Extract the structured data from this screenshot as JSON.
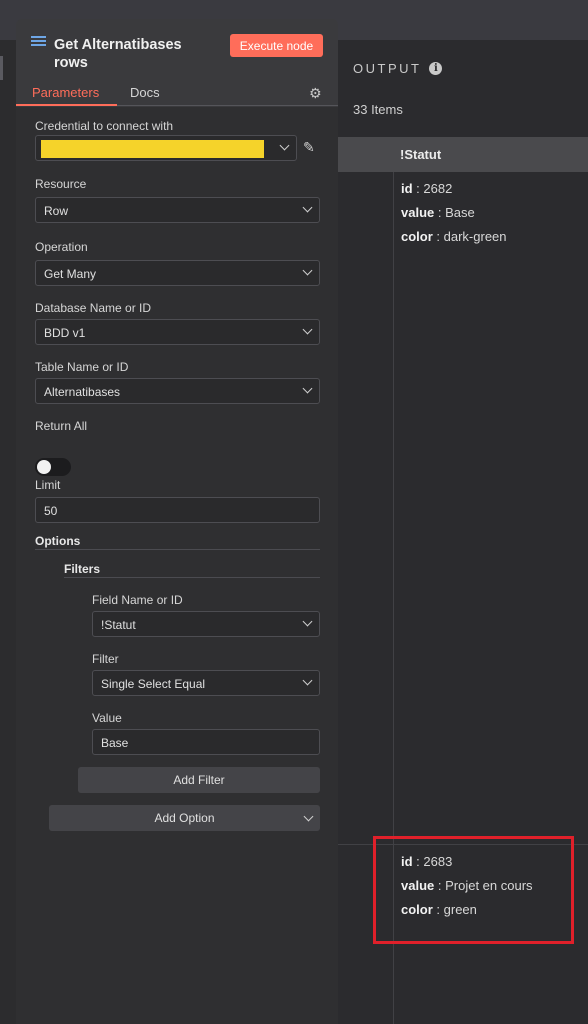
{
  "node": {
    "title": "Get Alternatibases rows",
    "execute_label": "Execute node",
    "tabs": [
      "Parameters",
      "Docs"
    ]
  },
  "params": {
    "credential_label": "Credential to connect with",
    "resource_label": "Resource",
    "resource_value": "Row",
    "operation_label": "Operation",
    "operation_value": "Get Many",
    "database_label": "Database Name or ID",
    "database_value": "BDD v1",
    "table_label": "Table Name or ID",
    "table_value": "Alternatibases",
    "return_all_label": "Return All",
    "return_all_on": false,
    "limit_label": "Limit",
    "limit_value": "50",
    "options_label": "Options",
    "filters_label": "Filters",
    "field_name_label": "Field Name or ID",
    "field_name_value": "!Statut",
    "filter_label": "Filter",
    "filter_value": "Single Select Equal",
    "value_label": "Value",
    "value_value": "Base",
    "add_filter_label": "Add Filter",
    "add_option_label": "Add Option"
  },
  "output": {
    "title": "OUTPUT",
    "count": "33 Items",
    "column": "!Statut",
    "items": [
      {
        "id": "2682",
        "value": "Base",
        "color": "dark-green"
      },
      {
        "id": "2683",
        "value": "Projet en cours",
        "color": "green"
      }
    ],
    "keys": {
      "id": "id",
      "value": "value",
      "color": "color"
    },
    "highlight_color": "#e0202a"
  },
  "colors": {
    "accent": "#ff6d5a",
    "credential_redacted": "#f5d32a"
  },
  "icons": [
    "table-icon",
    "info-icon",
    "gear-icon",
    "pencil-icon",
    "chevron-down-icon"
  ]
}
